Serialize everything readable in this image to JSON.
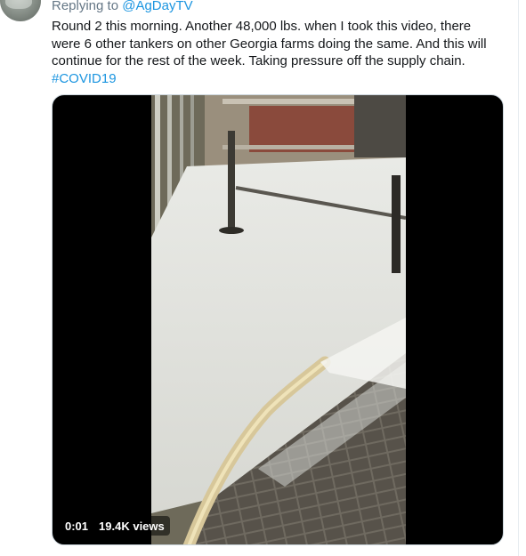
{
  "tweet": {
    "reply_prefix": "Replying to",
    "reply_handle": "@AgDayTV",
    "lines": [
      "Round 2 this morning. Another 48,000 lbs. when I took this video, there",
      "were 6 other tankers on other Georgia farms doing the same. And this will",
      "continue for the rest of the week. Taking pressure off the supply chain."
    ],
    "hashtag": "#COVID19"
  },
  "video": {
    "time": "0:01",
    "views": "19.4K views"
  },
  "colors": {
    "link": "#1b95e0",
    "text": "#14171a",
    "secondary": "#657786"
  },
  "icons": [
    "avatar"
  ]
}
